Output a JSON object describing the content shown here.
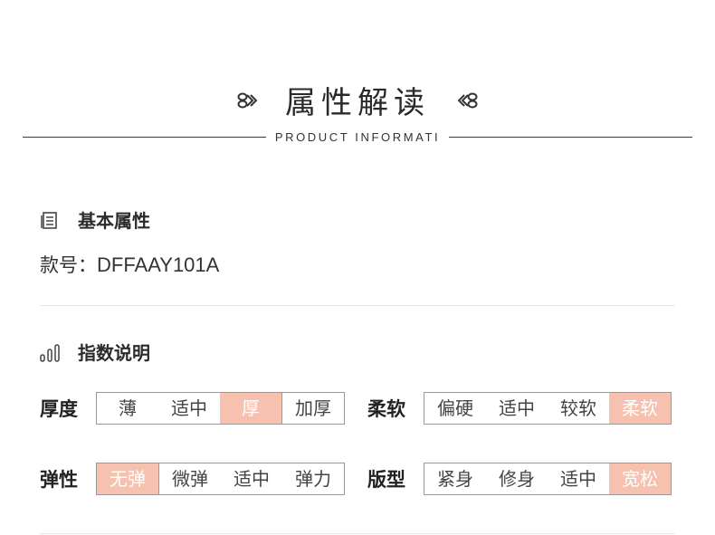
{
  "header": {
    "title": "属性解读",
    "subtitle": "PRODUCT INFORMATI"
  },
  "basic": {
    "section_label": "基本属性",
    "model_label": "款号：",
    "model_value": "DFFAAY101A",
    "icon": "document-list-icon"
  },
  "indices": {
    "section_label": "指数说明",
    "icon": "bar-chart-icon",
    "attributes": [
      {
        "label": "厚度",
        "options": [
          "薄",
          "适中",
          "厚",
          "加厚"
        ],
        "selected_index": 2
      },
      {
        "label": "柔软",
        "options": [
          "偏硬",
          "适中",
          "较软",
          "柔软"
        ],
        "selected_index": 3
      },
      {
        "label": "弹性",
        "options": [
          "无弹",
          "微弹",
          "适中",
          "弹力"
        ],
        "selected_index": 0
      },
      {
        "label": "版型",
        "options": [
          "紧身",
          "修身",
          "适中",
          "宽松"
        ],
        "selected_index": 3
      }
    ]
  },
  "colors": {
    "selected_bg": "#f6c1ae",
    "selected_text": "#ffffff",
    "border": "#9a9a9a"
  }
}
